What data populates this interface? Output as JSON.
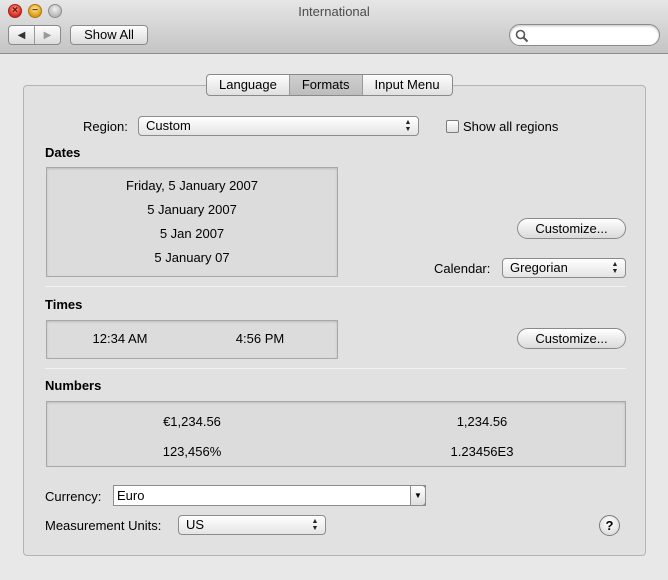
{
  "window": {
    "title": "International"
  },
  "toolbar": {
    "back_glyph": "◀",
    "forward_glyph": "▶",
    "show_all_label": "Show All",
    "search_placeholder": ""
  },
  "tabs": [
    {
      "label": "Language"
    },
    {
      "label": "Formats"
    },
    {
      "label": "Input Menu"
    }
  ],
  "region": {
    "label": "Region:",
    "value": "Custom",
    "show_all_regions_label": "Show all regions",
    "show_all_regions_checked": false
  },
  "dates": {
    "heading": "Dates",
    "samples": [
      "Friday, 5 January 2007",
      "5 January 2007",
      "5 Jan 2007",
      "5 January 07"
    ],
    "customize_label": "Customize...",
    "calendar_label": "Calendar:",
    "calendar_value": "Gregorian"
  },
  "times": {
    "heading": "Times",
    "samples": [
      "12:34 AM",
      "4:56 PM"
    ],
    "customize_label": "Customize..."
  },
  "numbers": {
    "heading": "Numbers",
    "samples": [
      "€1,234.56",
      "1,234.56",
      "123,456%",
      "1.23456E3"
    ]
  },
  "currency": {
    "label": "Currency:",
    "value": "Euro"
  },
  "measurement": {
    "label": "Measurement Units:",
    "value": "US"
  },
  "help": {
    "glyph": "?"
  },
  "colors": {
    "close": "#d6261c",
    "minimize": "#dd9a12",
    "zoom": "#b8b8b8"
  }
}
